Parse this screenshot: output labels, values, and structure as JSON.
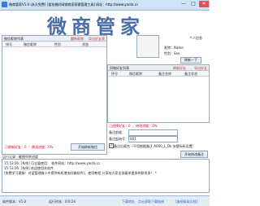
{
  "window": {
    "title": "微商管家V1.0 (永久免费) [爱妆微好网销商家获客管理工具] 网址：http://www.yanta.cc",
    "minimize": "—",
    "maximize": "□",
    "close": "✕"
  },
  "banner": {
    "logo_text": "微商管家"
  },
  "left_panel": {
    "header_title": "微信昵称列表",
    "header_link1": "翻新昵称",
    "header_link2": "导出好友表",
    "columns": [
      "排号",
      "微信昵称",
      "性别",
      "状态"
    ],
    "status_text": "已刷新好友：0 ｜ 刷选进度：0%",
    "button": "开始刷新微信"
  },
  "profile": {
    "login_hint": "个人信息",
    "name_label": "昵称：Name",
    "sex_label": "性别：Sex",
    "button1": "刷新一下",
    "button2": "上传信息"
  },
  "right_panel": {
    "header_title": "同微好友列表",
    "header_link1": "刷新好友",
    "header_link2": "导出好友",
    "columns": [
      "序号",
      "微信昵称",
      "备注名称",
      "备注状态"
    ],
    "status_text": "已选择好友：0 ｜ 修改进度：0%",
    "remark_prefix_label": "备注前缀：",
    "remark_prefix_value": "",
    "remark_begin_label": "备注起始号：",
    "remark_begin_value": "001",
    "checkbox_label": "备注后缀名（不用根据备注 A000_L_Ok 安替标码设置）",
    "button": "开始修改备注"
  },
  "log": {
    "title": "运行记录：截图列举进度",
    "lines": [
      "15:53:56: [系统] 可全量使用：  软件网站：http://www.yanta.cc",
      "15:53:56: [系统] 欢迎使用本软件",
      "[免费学习客服：对爱管理微小中提供有机增加同微软件]，使用教程:分享给大家全部要求更多的联系多！ *"
    ]
  },
  "statusbar": {
    "version": "软件版本：V1.0",
    "run_time": "运行时长：0:0:24",
    "link_update": "下载地址",
    "link_contact": "点击获取下载链接",
    "link_help": "[查阅帮助文档]"
  }
}
